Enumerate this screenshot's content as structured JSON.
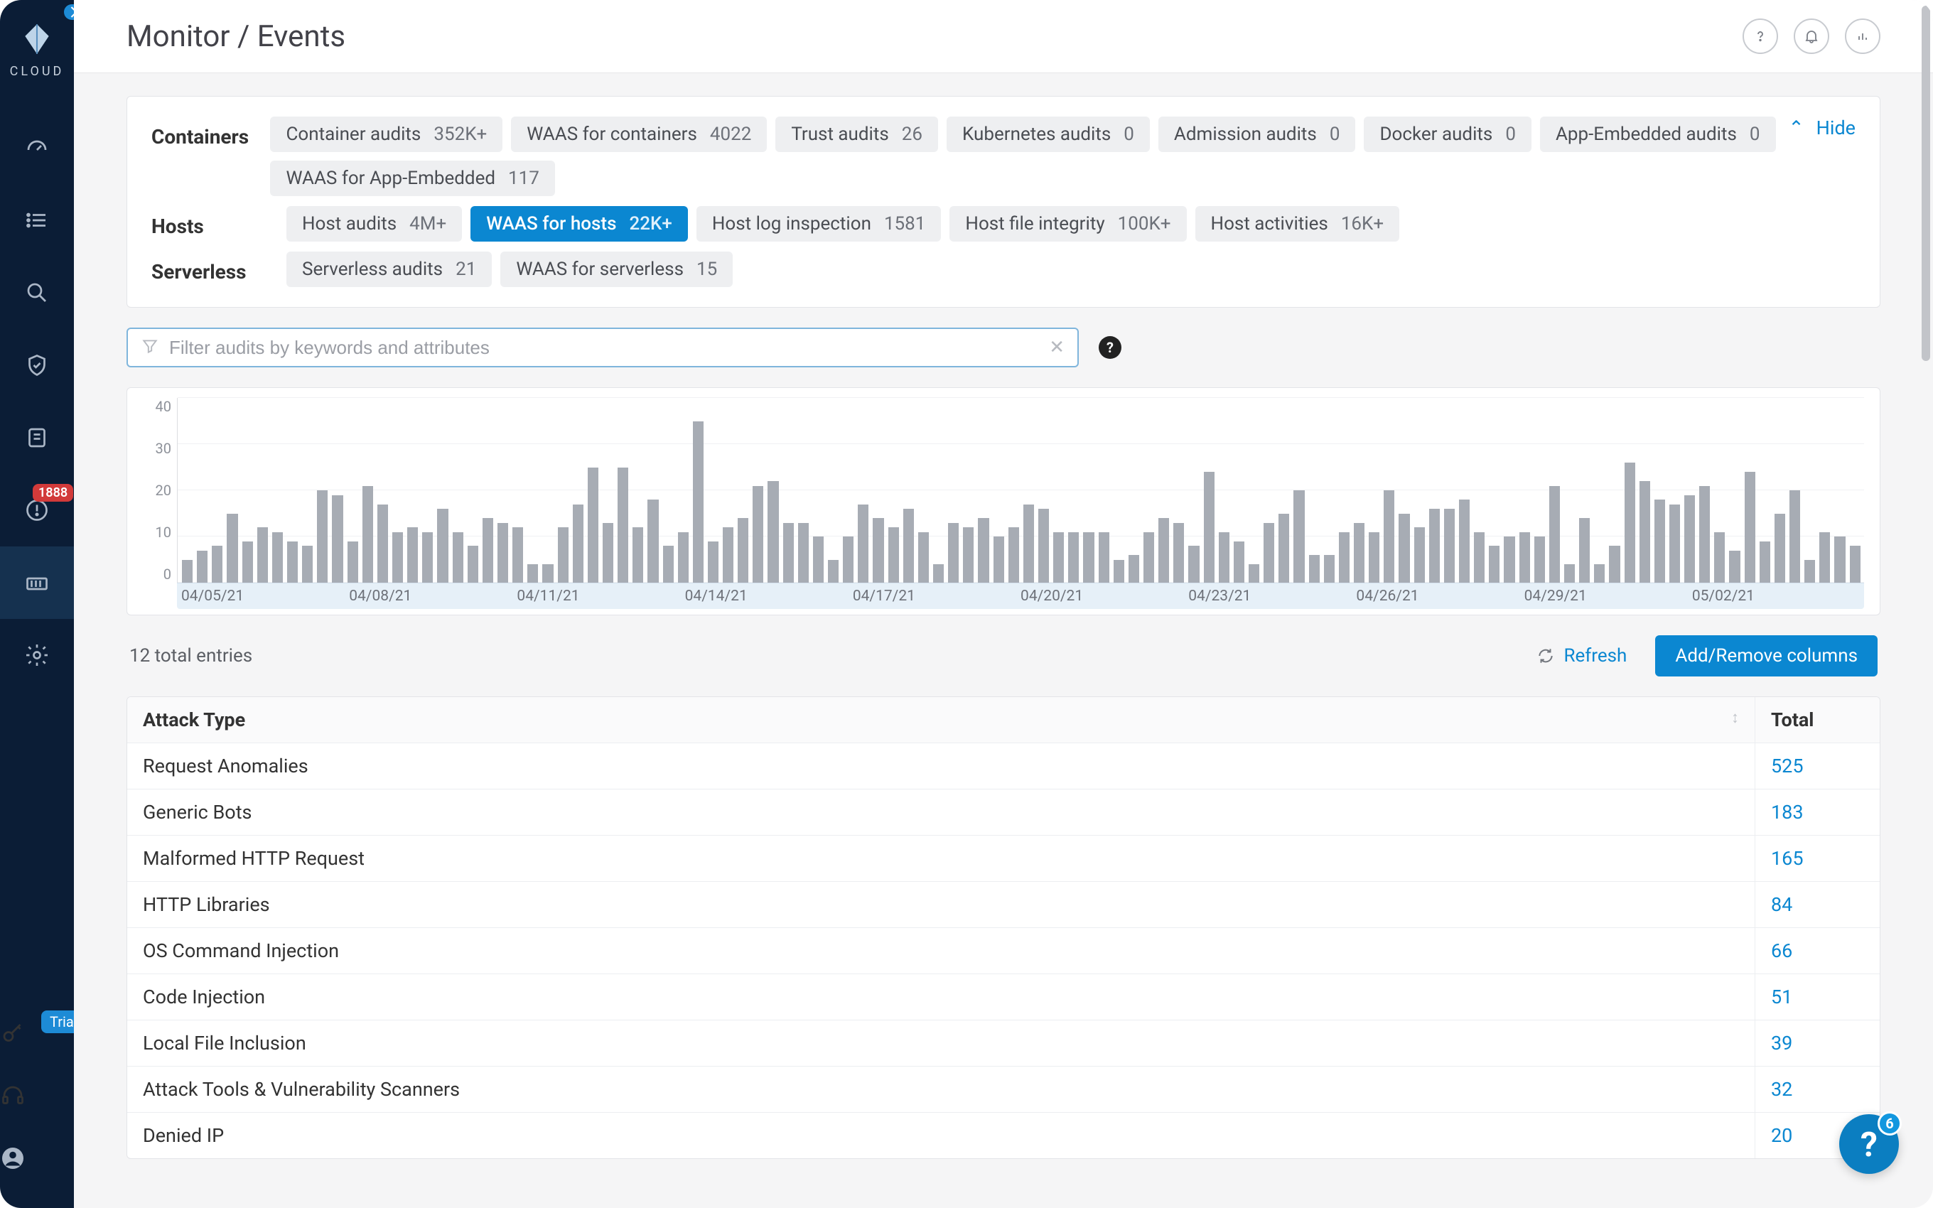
{
  "brand": {
    "name": "CLOUD"
  },
  "header": {
    "title": "Monitor / Events"
  },
  "sidebar": {
    "alert_badge": "1888",
    "trial_label": "Trial"
  },
  "filters": {
    "hide_label": "Hide",
    "groups": [
      {
        "label": "Containers",
        "pills": [
          {
            "name": "Container audits",
            "count": "352K+"
          },
          {
            "name": "WAAS for containers",
            "count": "4022"
          },
          {
            "name": "Trust audits",
            "count": "26"
          },
          {
            "name": "Kubernetes audits",
            "count": "0"
          },
          {
            "name": "Admission audits",
            "count": "0"
          },
          {
            "name": "Docker audits",
            "count": "0"
          },
          {
            "name": "App-Embedded audits",
            "count": "0"
          },
          {
            "name": "WAAS for App-Embedded",
            "count": "117"
          }
        ]
      },
      {
        "label": "Hosts",
        "pills": [
          {
            "name": "Host audits",
            "count": "4M+"
          },
          {
            "name": "WAAS for hosts",
            "count": "22K+",
            "active": true
          },
          {
            "name": "Host log inspection",
            "count": "1581"
          },
          {
            "name": "Host file integrity",
            "count": "100K+"
          },
          {
            "name": "Host activities",
            "count": "16K+"
          }
        ]
      },
      {
        "label": "Serverless",
        "pills": [
          {
            "name": "Serverless audits",
            "count": "21"
          },
          {
            "name": "WAAS for serverless",
            "count": "15"
          }
        ]
      }
    ]
  },
  "search": {
    "placeholder": "Filter audits by keywords and attributes"
  },
  "chart_data": {
    "type": "bar",
    "title": "",
    "xlabel": "",
    "ylabel": "",
    "ylim": [
      0,
      40
    ],
    "yticks": [
      0,
      10,
      20,
      30,
      40
    ],
    "xticks": [
      "04/05/21",
      "04/08/21",
      "04/11/21",
      "04/14/21",
      "04/17/21",
      "04/20/21",
      "04/23/21",
      "04/26/21",
      "04/29/21",
      "05/02/21"
    ],
    "values": [
      5,
      7,
      8,
      15,
      9,
      12,
      11,
      9,
      8,
      20,
      19,
      9,
      21,
      17,
      11,
      12,
      11,
      16,
      11,
      8,
      14,
      13,
      12,
      4,
      4,
      12,
      17,
      25,
      13,
      25,
      12,
      18,
      8,
      11,
      35,
      9,
      12,
      14,
      21,
      22,
      13,
      13,
      10,
      5,
      10,
      17,
      14,
      12,
      16,
      11,
      4,
      13,
      12,
      14,
      10,
      12,
      17,
      16,
      11,
      11,
      11,
      11,
      5,
      6,
      11,
      14,
      13,
      8,
      24,
      11,
      9,
      4,
      13,
      15,
      20,
      6,
      6,
      11,
      13,
      11,
      20,
      15,
      12,
      16,
      16,
      18,
      11,
      8,
      10,
      11,
      10,
      21,
      4,
      14,
      4,
      8,
      26,
      22,
      18,
      17,
      19,
      21,
      11,
      7,
      24,
      9,
      15,
      20,
      5,
      11,
      10,
      8
    ]
  },
  "table": {
    "total_entries": "12 total entries",
    "refresh": "Refresh",
    "add_remove": "Add/Remove columns",
    "headers": {
      "c1": "Attack Type",
      "c2": "Total"
    },
    "rows": [
      {
        "name": "Request Anomalies",
        "total": "525"
      },
      {
        "name": "Generic Bots",
        "total": "183"
      },
      {
        "name": "Malformed HTTP Request",
        "total": "165"
      },
      {
        "name": "HTTP Libraries",
        "total": "84"
      },
      {
        "name": "OS Command Injection",
        "total": "66"
      },
      {
        "name": "Code Injection",
        "total": "51"
      },
      {
        "name": "Local File Inclusion",
        "total": "39"
      },
      {
        "name": "Attack Tools & Vulnerability Scanners",
        "total": "32"
      },
      {
        "name": "Denied IP",
        "total": "20"
      }
    ]
  },
  "floating_help": {
    "count": "6"
  }
}
